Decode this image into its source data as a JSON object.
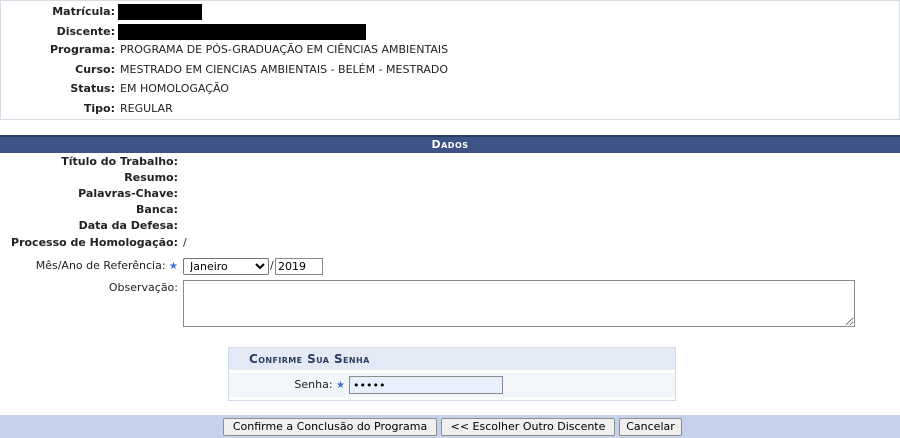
{
  "info": {
    "rows": [
      {
        "label": "Matrícula:",
        "value": ""
      },
      {
        "label": "Discente:",
        "value": ""
      },
      {
        "label": "Programa:",
        "value": "PROGRAMA DE PÓS-GRADUAÇÃO EM CIÊNCIAS AMBIENTAIS"
      },
      {
        "label": "Curso:",
        "value": "MESTRADO EM CIENCIAS AMBIENTAIS - BELÉM - MESTRADO"
      },
      {
        "label": "Status:",
        "value": "EM HOMOLOGAÇÃO"
      },
      {
        "label": "Tipo:",
        "value": "REGULAR"
      }
    ]
  },
  "dados": {
    "title": "Dados",
    "fields": [
      {
        "label": "Título do Trabalho:",
        "value": ""
      },
      {
        "label": "Resumo:",
        "value": ""
      },
      {
        "label": "Palavras-Chave:",
        "value": ""
      },
      {
        "label": "Banca:",
        "value": ""
      },
      {
        "label": "Data da Defesa:",
        "value": ""
      },
      {
        "label": "Processo de Homologação:",
        "value": "/"
      }
    ],
    "mes_ano": {
      "label": "Mês/Ano de Referência:",
      "required_mark": "★",
      "month_selected": "Janeiro",
      "separator": "/",
      "year_value": "2019"
    },
    "observacao": {
      "label": "Observação:",
      "value": ""
    }
  },
  "senha": {
    "title": "Confirme Sua Senha",
    "label": "Senha:",
    "required_mark": "★",
    "value": "•••••"
  },
  "buttons": {
    "confirm": "Confirme a Conclusão do Programa",
    "choose_other": "<< Escolher Outro Discente",
    "cancel": "Cancelar"
  },
  "colors": {
    "header_bar": "#3d5385",
    "footer_bar": "#c5d2e9",
    "required_star": "#3b73c8"
  }
}
